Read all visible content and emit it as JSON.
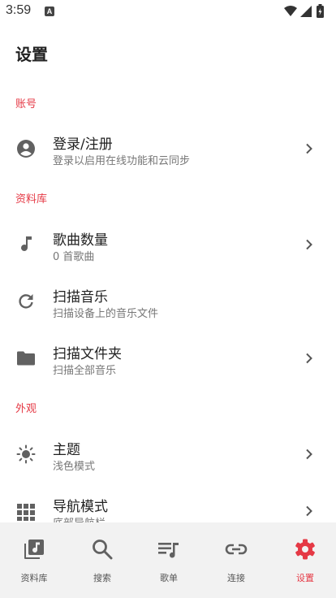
{
  "status_bar": {
    "time": "3:59",
    "notification_badge": "A"
  },
  "page_title": "设置",
  "sections": [
    {
      "header": "账号",
      "items": [
        {
          "title": "登录/注册",
          "subtitle": "登录以启用在线功能和云同步",
          "icon": "account-circle-icon",
          "has_chevron": true
        }
      ]
    },
    {
      "header": "资料库",
      "items": [
        {
          "title": "歌曲数量",
          "subtitle": "0 首歌曲",
          "icon": "music-note-icon",
          "has_chevron": true
        },
        {
          "title": "扫描音乐",
          "subtitle": "扫描设备上的音乐文件",
          "icon": "refresh-icon",
          "has_chevron": false
        },
        {
          "title": "扫描文件夹",
          "subtitle": "扫描全部音乐",
          "icon": "folder-icon",
          "has_chevron": true
        }
      ]
    },
    {
      "header": "外观",
      "items": [
        {
          "title": "主题",
          "subtitle": "浅色模式",
          "icon": "brightness-icon",
          "has_chevron": true
        },
        {
          "title": "导航模式",
          "subtitle": "底部导航栏",
          "icon": "grid-icon",
          "has_chevron": true
        }
      ]
    }
  ],
  "bottom_nav": {
    "items": [
      {
        "label": "资料库",
        "icon": "library-music-icon",
        "active": false
      },
      {
        "label": "搜索",
        "icon": "search-icon",
        "active": false
      },
      {
        "label": "歌单",
        "icon": "playlist-icon",
        "active": false
      },
      {
        "label": "连接",
        "icon": "link-icon",
        "active": false
      },
      {
        "label": "设置",
        "icon": "gear-icon",
        "active": true
      }
    ]
  },
  "colors": {
    "accent": "#e53945",
    "icon_gray": "#616161",
    "nav_background": "#f2f2f2"
  }
}
